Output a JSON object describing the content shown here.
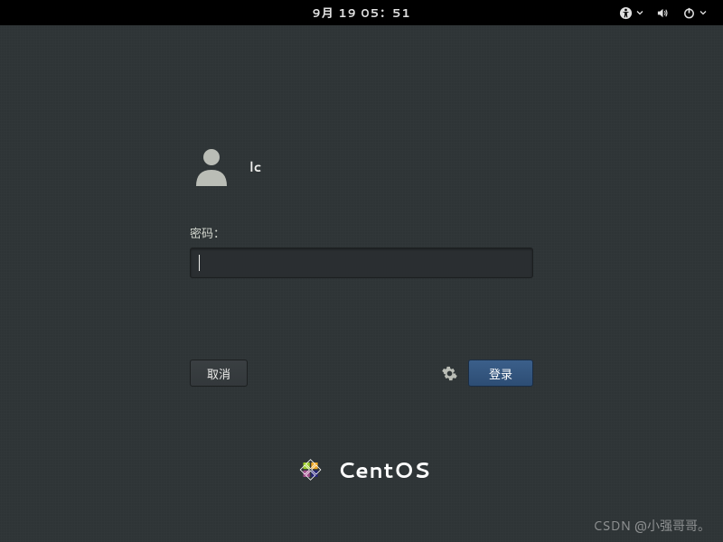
{
  "topbar": {
    "datetime": "9月 19 05：51"
  },
  "login": {
    "username": "lc",
    "password_label": "密码：",
    "password_value": "",
    "cancel_label": "取消",
    "login_label": "登录"
  },
  "branding": {
    "name": "CentOS"
  },
  "watermark": "CSDN @小强哥哥。",
  "colors": {
    "background": "#2e3436",
    "accent": "#3b5f8a",
    "text": "#eeeeec"
  }
}
